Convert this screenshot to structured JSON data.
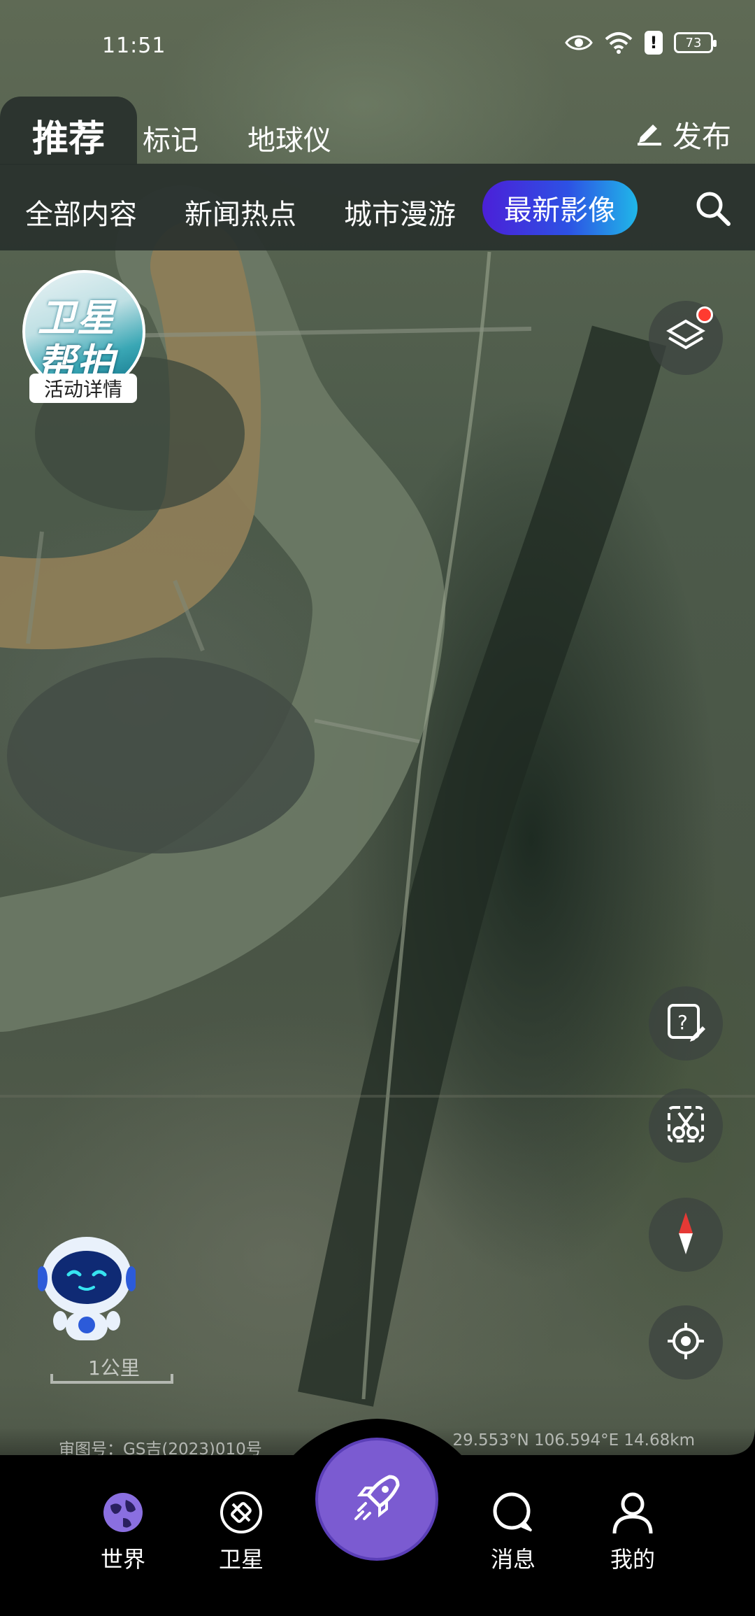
{
  "status_bar": {
    "time": "11:51",
    "battery": "73",
    "icons": [
      "eye-icon",
      "wifi-icon",
      "alert-icon",
      "battery-icon"
    ]
  },
  "top_tabs": {
    "items": [
      {
        "label": "推荐",
        "active": true
      },
      {
        "label": "标记",
        "active": false
      },
      {
        "label": "地球仪",
        "active": false
      }
    ],
    "publish_label": "发布"
  },
  "categories": {
    "items": [
      {
        "label": "全部内容",
        "active": false
      },
      {
        "label": "新闻热点",
        "active": false
      },
      {
        "label": "城市漫游",
        "active": false
      },
      {
        "label": "最新影像",
        "active": true
      }
    ],
    "active_gradient": [
      "#4b20d8",
      "#20b7e8"
    ]
  },
  "badge": {
    "line1": "卫星",
    "line2": "帮拍",
    "detail": "活动详情"
  },
  "map_tools": [
    "layers-icon",
    "help-edit-icon",
    "screenshot-icon",
    "compass-icon",
    "locate-icon"
  ],
  "scale": {
    "label": "1公里"
  },
  "info": {
    "approval": "审图号：GS吉(2023)010号",
    "coords": "29.553°N 106.594°E 14.68km"
  },
  "bottom_nav": {
    "items": [
      {
        "label": "世界",
        "icon": "globe-icon"
      },
      {
        "label": "卫星",
        "icon": "satellite-icon"
      },
      {
        "label": "消息",
        "icon": "message-icon"
      },
      {
        "label": "我的",
        "icon": "user-icon"
      }
    ],
    "center_icon": "rocket-icon",
    "accent": "#7b5bd1"
  }
}
